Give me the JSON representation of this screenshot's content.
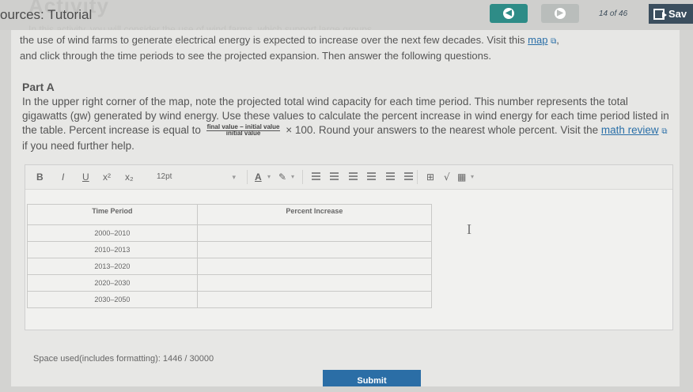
{
  "header": {
    "breadcrumb": "ources: Tutorial",
    "ghost_heading": "Activity",
    "ghost_text": "In this activity, you will consider the use of wind farms, which support large groups",
    "prev_icon": "arrow-left-circle-icon",
    "next_icon": "arrow-right-circle-icon",
    "counter": "14 of 46",
    "save_label": "Sav",
    "save_icon": "save-exit-icon",
    "accent_color": "#2e8c87"
  },
  "intro": {
    "line1": "the use of wind farms to generate electrical energy is expected to increase over the next few decades. Visit this ",
    "link": "map",
    "line1_end": ",",
    "line2": "and click through the time periods to see the projected expansion. Then answer the following questions."
  },
  "partA": {
    "title": "Part A",
    "text1": "In the upper right corner of the map, note the projected total wind capacity for each time period. This number represents the total gigawatts (gw) generated by wind energy. Use these values to calculate the percent increase in wind energy for each time period listed in the table. Percent increase is equal to",
    "frac_num": "final value − initial value",
    "frac_den": "initial value",
    "text2": "× 100. Round your answers to the nearest whole percent. Visit the ",
    "link": "math review",
    "text3": " if you need further help."
  },
  "toolbar": {
    "bold": "B",
    "italic": "I",
    "underline": "U",
    "superscript": "x²",
    "subscript": "x₂",
    "font_size": "12pt",
    "font_color_icon": "font-color-icon",
    "highlight_icon": "highlight-icon"
  },
  "table": {
    "headers": [
      "Time Period",
      "Percent Increase"
    ],
    "rows": [
      [
        "2000–2010",
        ""
      ],
      [
        "2010–2013",
        ""
      ],
      [
        "2013–2020",
        ""
      ],
      [
        "2020–2030",
        ""
      ],
      [
        "2030–2050",
        ""
      ]
    ]
  },
  "footer": {
    "space_used": "Space used(includes formatting): 1446 / 30000",
    "submit_label": "Submit"
  }
}
